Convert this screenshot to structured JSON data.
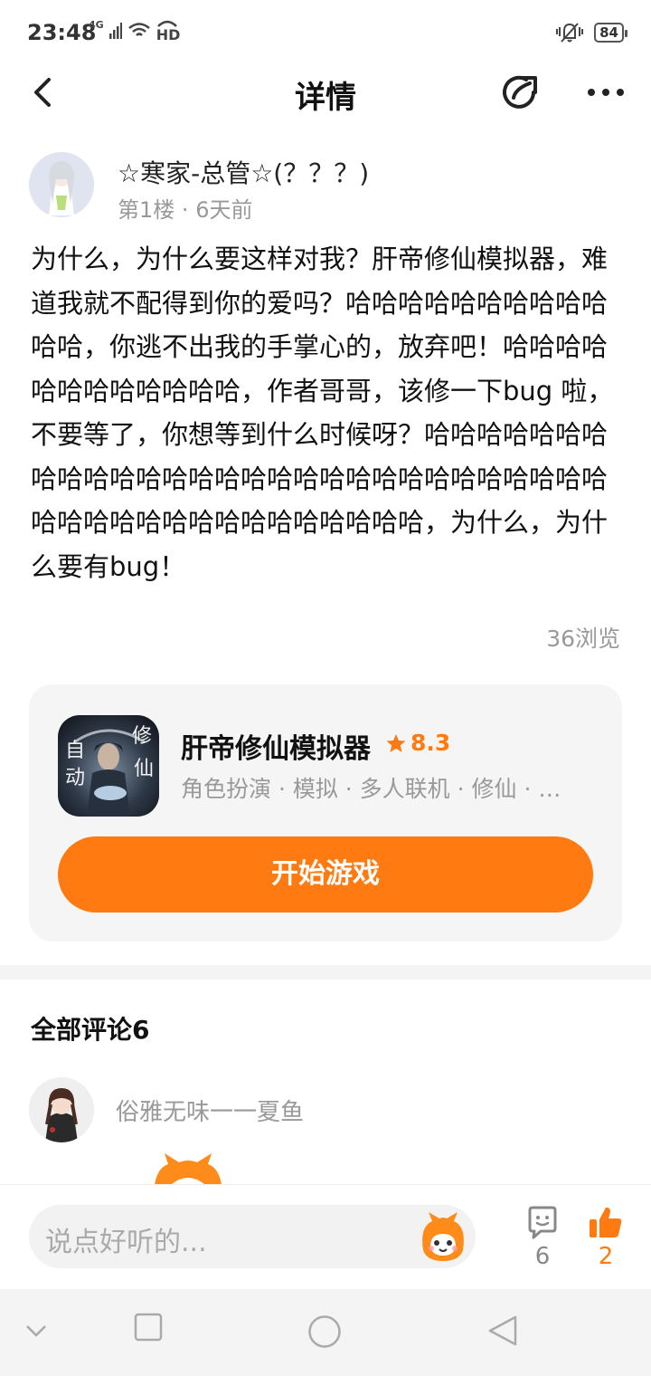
{
  "status_bar": {
    "time": "23:48",
    "network": "4G",
    "wifi_label": "HD",
    "battery": "84"
  },
  "nav": {
    "title": "详情"
  },
  "post": {
    "author_name": "☆寒家-总管☆(？？？)",
    "floor": "第1楼",
    "time_ago": "6天前",
    "content": "为什么，为什么要这样对我？肝帝修仙模拟器，难道我就不配得到你的爱吗？哈哈哈哈哈哈哈哈哈哈哈哈，你逃不出我的手掌心的，放弃吧！哈哈哈哈哈哈哈哈哈哈哈哈，作者哥哥，该修一下bug 啦，不要等了，你想等到什么时候呀？哈哈哈哈哈哈哈哈哈哈哈哈哈哈哈哈哈哈哈哈哈哈哈哈哈哈哈哈哈哈哈哈哈哈哈哈哈哈哈哈哈哈哈哈，为什么，为什么要有bug！",
    "views": "36浏览"
  },
  "game_card": {
    "name": "肝帝修仙模拟器",
    "rating": "8.3",
    "tags": "角色扮演 · 模拟 · 多人联机 · 修仙 · …",
    "icon_text_left": "自动",
    "icon_text_right": "修仙",
    "play_label": "开始游戏"
  },
  "comments": {
    "title": "全部评论6",
    "first_user": "俗雅无味一一夏鱼"
  },
  "bottom_bar": {
    "input_placeholder": "说点好听的...",
    "comment_count": "6",
    "like_count": "2"
  },
  "icons": {
    "back": "chevron-left-icon",
    "share": "share-icon",
    "more": "more-dots-icon",
    "star": "star-icon",
    "comment": "comment-bubble-icon",
    "like": "thumbs-up-icon",
    "emoji": "emoji-mascot-icon"
  },
  "colors": {
    "accent": "#ff7a10",
    "muted_text": "#999999",
    "card_bg": "#f5f5f5"
  }
}
